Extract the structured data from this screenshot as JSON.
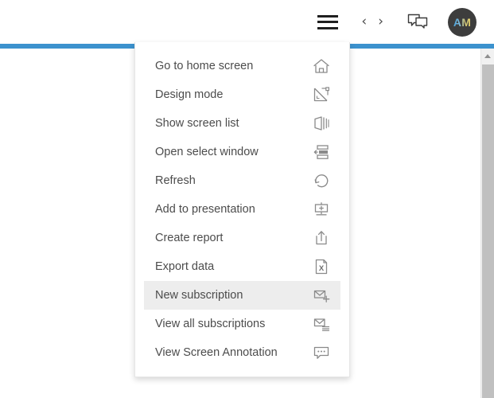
{
  "header": {
    "menu_button": "hamburger-menu",
    "nav_back": "‹",
    "nav_forward": "›",
    "chat_button": "chat-bubbles",
    "avatar_initials": "AM"
  },
  "accent_color": "#3c92ce",
  "highlight_color": "#ededed",
  "text_color": "#4c4c4c",
  "icon_color": "#8a8a8a",
  "menu": {
    "items": [
      {
        "label": "Go to home screen",
        "icon": "home-icon",
        "active": false
      },
      {
        "label": "Design mode",
        "icon": "design-mode-icon",
        "active": false
      },
      {
        "label": "Show screen list",
        "icon": "screen-list-icon",
        "active": false
      },
      {
        "label": "Open select window",
        "icon": "select-window-icon",
        "active": false
      },
      {
        "label": "Refresh",
        "icon": "refresh-icon",
        "active": false
      },
      {
        "label": "Add to presentation",
        "icon": "add-presentation-icon",
        "active": false
      },
      {
        "label": "Create report",
        "icon": "create-report-icon",
        "active": false
      },
      {
        "label": "Export data",
        "icon": "export-data-icon",
        "active": false
      },
      {
        "label": "New subscription",
        "icon": "new-subscription-icon",
        "active": true
      },
      {
        "label": "View all subscriptions",
        "icon": "all-subscriptions-icon",
        "active": false
      },
      {
        "label": "View Screen Annotation",
        "icon": "annotation-icon",
        "active": false
      }
    ]
  },
  "scrollbar": {
    "up_arrow": "scroll-up-arrow"
  }
}
